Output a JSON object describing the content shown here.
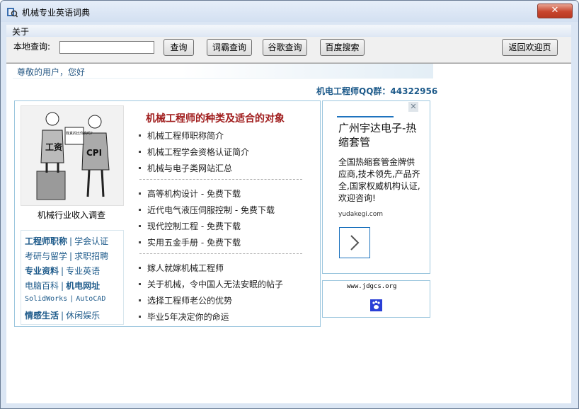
{
  "window": {
    "title": "机械专业英语词典",
    "close_label": "✕"
  },
  "menu": {
    "about": "关于"
  },
  "toolbar": {
    "local_query_label": "本地查询:",
    "search_value": "",
    "buttons": {
      "query": "查询",
      "iciba": "词霸查询",
      "google": "谷歌查询",
      "baidu": "百度搜索",
      "back_home": "返回欢迎页"
    }
  },
  "page": {
    "greeting": "尊敬的用户，您好",
    "qq_group": "机电工程师QQ群：44322956",
    "survey": {
      "image_text_left": "工资",
      "image_text_right": "CPI",
      "image_bubble": "我真的比你高吗?",
      "caption": "机械行业收入调查"
    },
    "categories": {
      "row1": [
        "工程师职称",
        "学会认证"
      ],
      "row2": [
        "考研与留学",
        "求职招聘"
      ],
      "row3": [
        "专业资料",
        "专业英语"
      ],
      "row4": [
        "电脑百科",
        "机电网址"
      ],
      "row5": [
        "SolidWorks",
        "AutoCAD"
      ],
      "row6": [
        "情感生活",
        "休闲娱乐"
      ]
    },
    "links_title": "机械工程师的种类及适合的对象",
    "links_group1": [
      "机械工程师职称简介",
      "机械工程学会资格认证简介",
      "机械与电子类网站汇总"
    ],
    "links_group2": [
      "高等机构设计 - 免费下载",
      "近代电气液压伺服控制 - 免费下载",
      "现代控制工程 - 免费下载",
      "实用五金手册 - 免费下载"
    ],
    "links_group3": [
      "嫁人就嫁机械工程师",
      "关于机械，令中国人无法安眠的帖子",
      "选择工程师老公的优势",
      "毕业5年决定你的命运"
    ]
  },
  "ad": {
    "close": "✕",
    "title": "广州宇达电子-热缩套管",
    "body": "全国热缩套管金牌供应商,技术领先,产品齐全,国家权威机构认证,欢迎咨询!",
    "domain": "yudakegi.com"
  },
  "jdgcs": {
    "url": "www.jdgcs.org"
  },
  "colors": {
    "link_blue": "#1d5a8a",
    "title_red": "#a01d1d",
    "border_blue": "#9cc6de",
    "close_red": "#c8452d"
  }
}
